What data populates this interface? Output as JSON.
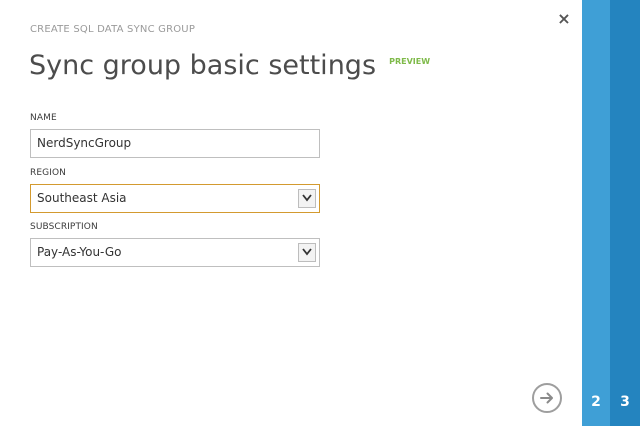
{
  "dialog": {
    "supertitle": "CREATE SQL DATA SYNC GROUP",
    "title": "Sync group basic settings",
    "badge": "PREVIEW",
    "close_icon": "×"
  },
  "form": {
    "name": {
      "label": "NAME",
      "value": "NerdSyncGroup"
    },
    "region": {
      "label": "REGION",
      "value": "Southeast Asia"
    },
    "subscription": {
      "label": "SUBSCRIPTION",
      "value": "Pay-As-You-Go"
    }
  },
  "steps": [
    {
      "number": "2"
    },
    {
      "number": "3"
    }
  ],
  "colors": {
    "accent": "#2a8dc8",
    "preview": "#7fba4a",
    "focus": "#d39a2f"
  },
  "icons": {
    "close": "close-icon",
    "next": "arrow-right-icon",
    "dropdown": "chevron-down-icon"
  }
}
